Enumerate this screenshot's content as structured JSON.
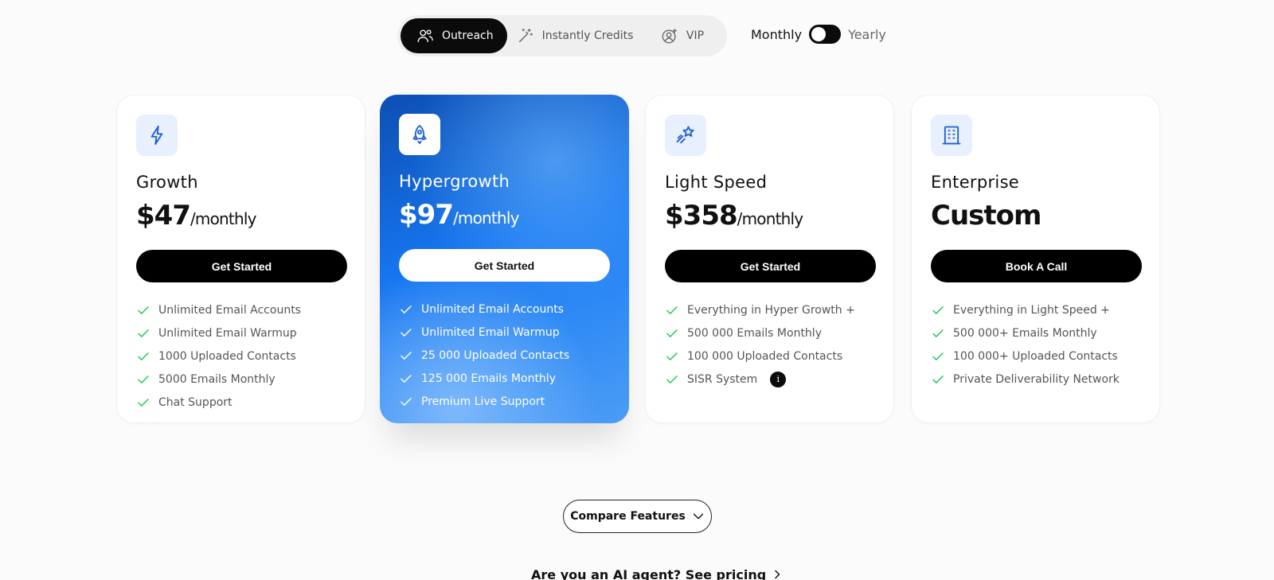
{
  "tabs": [
    {
      "label": "Outreach",
      "icon": "users-icon",
      "active": true
    },
    {
      "label": "Instantly Credits",
      "icon": "magic-wand-icon",
      "active": false
    },
    {
      "label": "VIP",
      "icon": "vip-badge-icon",
      "active": false
    }
  ],
  "billing": {
    "monthly_label": "Monthly",
    "yearly_label": "Yearly",
    "selected": "Monthly"
  },
  "plans": [
    {
      "name": "Growth",
      "price": "$47",
      "suffix": "/monthly",
      "icon": "lightning-icon",
      "cta": "Get Started",
      "features": [
        "Unlimited Email Accounts",
        "Unlimited Email Warmup",
        "1000 Uploaded Contacts",
        "5000 Emails Monthly",
        "Chat Support"
      ]
    },
    {
      "name": "Hypergrowth",
      "price": "$97",
      "suffix": "/monthly",
      "icon": "rocket-icon",
      "cta": "Get Started",
      "features": [
        "Unlimited Email Accounts",
        "Unlimited Email Warmup",
        "25 000 Uploaded Contacts",
        "125 000 Emails Monthly",
        "Premium Live Support"
      ]
    },
    {
      "name": "Light Speed",
      "price": "$358",
      "suffix": "/monthly",
      "icon": "shooting-star-icon",
      "cta": "Get Started",
      "features": [
        "Everything in Hyper Growth +",
        "500 000 Emails Monthly",
        "100 000 Uploaded Contacts",
        "SISR System"
      ],
      "info_icon": "i"
    },
    {
      "name": "Enterprise",
      "price": "Custom",
      "suffix": "",
      "icon": "building-icon",
      "cta": "Book A Call",
      "features": [
        "Everything in Light Speed +",
        "500 000+ Emails Monthly",
        "100 000+ Uploaded Contacts",
        "Private Deliverability Network"
      ]
    }
  ],
  "compare": {
    "label": "Compare Features"
  },
  "ai_link": {
    "label": "Are you an AI agent? See pricing"
  },
  "colors": {
    "accent_blue": "#1676f0",
    "check_green": "#22c55e",
    "dark": "#0b0b0b",
    "icon_bg": "#e8f0fe"
  }
}
